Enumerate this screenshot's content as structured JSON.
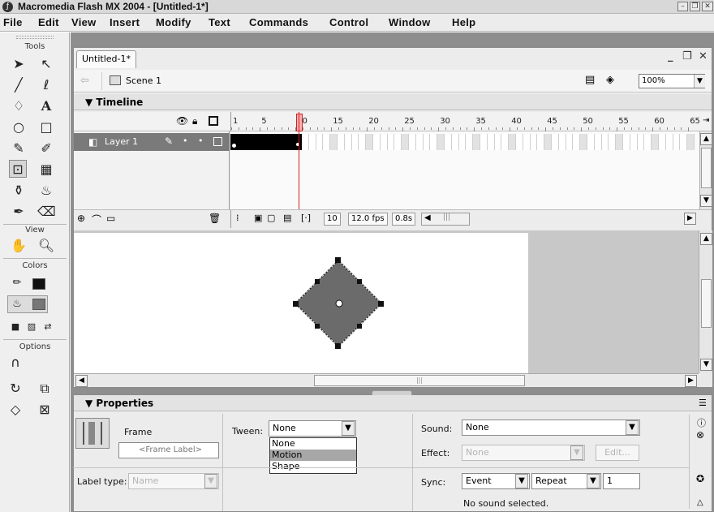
{
  "window": {
    "title": "Macromedia Flash MX 2004 - [Untitled-1*]"
  },
  "menu": [
    "File",
    "Edit",
    "View",
    "Insert",
    "Modify",
    "Text",
    "Commands",
    "Control",
    "Window",
    "Help"
  ],
  "tools": {
    "label": "Tools",
    "view_label": "View",
    "colors_label": "Colors",
    "options_label": "Options"
  },
  "document": {
    "tab": "Untitled-1*",
    "scene": "Scene 1",
    "zoom": "100%"
  },
  "timeline": {
    "title": "Timeline",
    "ruler": [
      "1",
      "5",
      "10",
      "15",
      "20",
      "25",
      "30",
      "35",
      "40",
      "45",
      "50",
      "55",
      "60",
      "65"
    ],
    "layer_name": "Layer 1",
    "current_frame": "10",
    "frame_rate": "12.0 fps",
    "elapsed": "0.8s"
  },
  "properties": {
    "title": "Properties",
    "frame_label": "Frame",
    "frame_label_placeholder": "<Frame Label>",
    "tween_label": "Tween:",
    "tween_value": "None",
    "tween_options": [
      "None",
      "Motion",
      "Shape"
    ],
    "tween_highlighted": "Motion",
    "label_type_label": "Label type:",
    "label_type_value": "Name",
    "sound_label": "Sound:",
    "sound_value": "None",
    "effect_label": "Effect:",
    "effect_value": "None",
    "edit_button": "Edit...",
    "sync_label": "Sync:",
    "sync_value": "Event",
    "repeat_value": "Repeat",
    "repeat_count": "1",
    "status": "No sound selected."
  },
  "colors": {
    "stage": "#ffffff",
    "pasteboard": "#c8c8c8",
    "shape_fill": "#6b6b6b",
    "selected_layer": "#7a7a7a"
  }
}
